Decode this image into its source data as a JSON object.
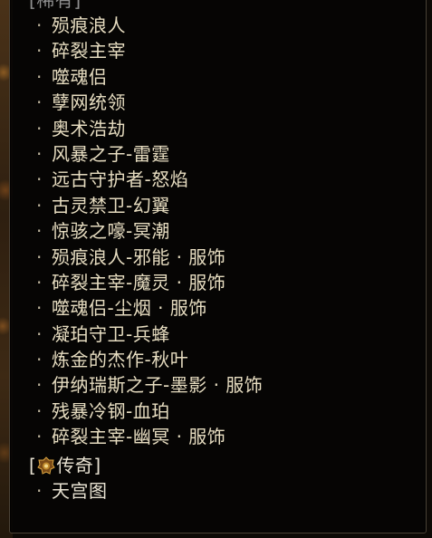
{
  "rare_section": {
    "header": "稀有",
    "items": [
      "殒痕浪人",
      "碎裂主宰",
      "噬魂侣",
      "孽网统领",
      "奥术浩劫",
      "风暴之子-雷霆",
      "远古守护者-怒焰",
      "古灵禁卫-幻翼",
      "惊骇之嚎-冥潮",
      "殒痕浪人-邪能 · 服饰",
      "碎裂主宰-魔灵 · 服饰",
      "噬魂侣-尘烟 · 服饰",
      "凝珀守卫-兵蜂",
      "炼金的杰作-秋叶",
      "伊纳瑞斯之子-墨影 · 服饰",
      "残暴冷钢-血珀",
      "碎裂主宰-幽冥 · 服饰"
    ]
  },
  "legendary_section": {
    "header": "传奇",
    "icon": "legendary-emblem-icon",
    "items": [
      "天宫图"
    ]
  },
  "bullet": "·",
  "colors": {
    "panel_bg": "#060504",
    "item_text": "#e6dcc0",
    "rare_header": "#8f8f8f",
    "legend_header": "#e8e2d2",
    "emblem_gold": "#c08a2c"
  }
}
